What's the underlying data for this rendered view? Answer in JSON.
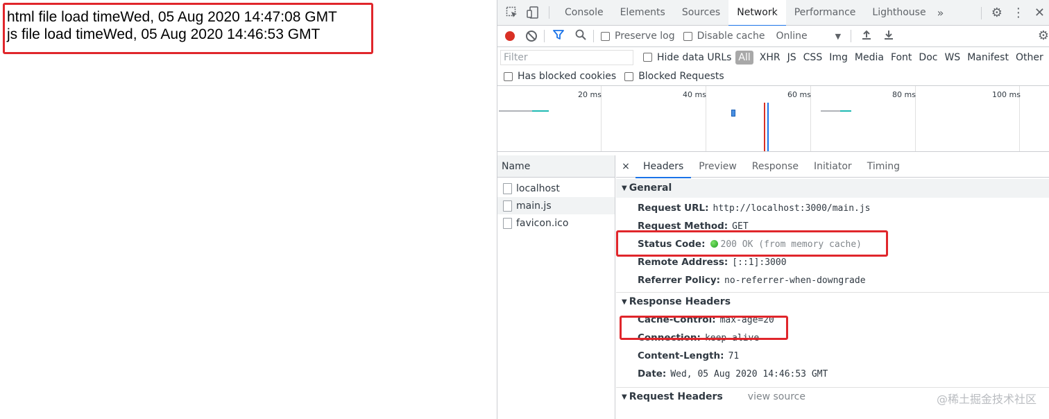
{
  "page": {
    "lines": [
      "html file load timeWed, 05 Aug 2020 14:47:08 GMT",
      "js file load timeWed, 05 Aug 2020 14:46:53 GMT"
    ]
  },
  "devtools": {
    "tabs": [
      "Console",
      "Elements",
      "Sources",
      "Network",
      "Performance",
      "Lighthouse"
    ],
    "active_tab": "Network",
    "more": "»",
    "toolbar": {
      "preserve_log": "Preserve log",
      "disable_cache": "Disable cache",
      "throttle": "Online",
      "throttle_arrow": "▼"
    },
    "filter": {
      "placeholder": "Filter",
      "hide_data_urls": "Hide data URLs",
      "types": [
        "All",
        "XHR",
        "JS",
        "CSS",
        "Img",
        "Media",
        "Font",
        "Doc",
        "WS",
        "Manifest",
        "Other"
      ],
      "has_blocked_cookies": "Has blocked cookies",
      "blocked_requests": "Blocked Requests"
    },
    "overview": {
      "ticks": [
        "20 ms",
        "40 ms",
        "60 ms",
        "80 ms",
        "100 ms"
      ]
    },
    "requests": {
      "header": "Name",
      "items": [
        "localhost",
        "main.js",
        "favicon.ico"
      ],
      "selected": "main.js"
    },
    "details": {
      "close": "×",
      "tabs": [
        "Headers",
        "Preview",
        "Response",
        "Initiator",
        "Timing"
      ],
      "active_tab": "Headers",
      "general": {
        "title": "General",
        "request_url_k": "Request URL:",
        "request_url_v": "http://localhost:3000/main.js",
        "request_method_k": "Request Method:",
        "request_method_v": "GET",
        "status_code_k": "Status Code:",
        "status_code_v": "200 OK (from memory cache)",
        "remote_address_k": "Remote Address:",
        "remote_address_v": "[::1]:3000",
        "referrer_policy_k": "Referrer Policy:",
        "referrer_policy_v": "no-referrer-when-downgrade"
      },
      "response_headers": {
        "title": "Response Headers",
        "cache_control_k": "Cache-Control:",
        "cache_control_v": "max-age=20",
        "connection_k": "Connection:",
        "connection_v": "keep-alive",
        "content_length_k": "Content-Length:",
        "content_length_v": "71",
        "date_k": "Date:",
        "date_v": "Wed, 05 Aug 2020 14:46:53 GMT"
      },
      "request_headers": {
        "title": "Request Headers",
        "view_source": "view source"
      }
    }
  },
  "watermark": "@稀土掘金技术社区",
  "colors": {
    "highlight": "#e0262b",
    "record": "#d93025",
    "active_tab_underline": "#1a73e8"
  }
}
